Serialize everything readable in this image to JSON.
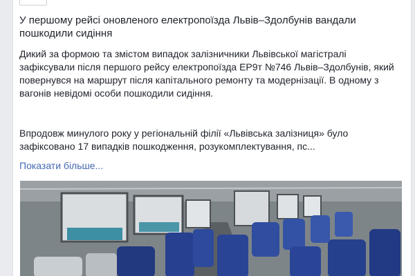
{
  "post": {
    "headline": "У першому рейсі оновленого електропоїзда Львів–Здолбунів вандали пошкодили сидіння",
    "paragraph_1": "Дикий за формою та змістом випадок залізничники Львівської магістралі зафіксували після першого рейсу електропоїзда ЕР9т №746 Львів–Здолбунів, який повернувся на маршрут після капітального ремонту та модернізації. В одному з вагонів невідомі особи пошкодили сидіння.",
    "paragraph_2": "Впродовж минулого року у регіональній філії «Львівська залізниця» було зафіксовано 17 випадків пошкодження, розукомплектування, пс...",
    "see_more_label": "Показати більше..."
  },
  "photo": {
    "subject": "train-car-interior-blue-seats"
  },
  "colors": {
    "link": "#4267b2",
    "text": "#1d2129",
    "page_bg": "#e9ebee",
    "seat_blue": "#27408f"
  }
}
